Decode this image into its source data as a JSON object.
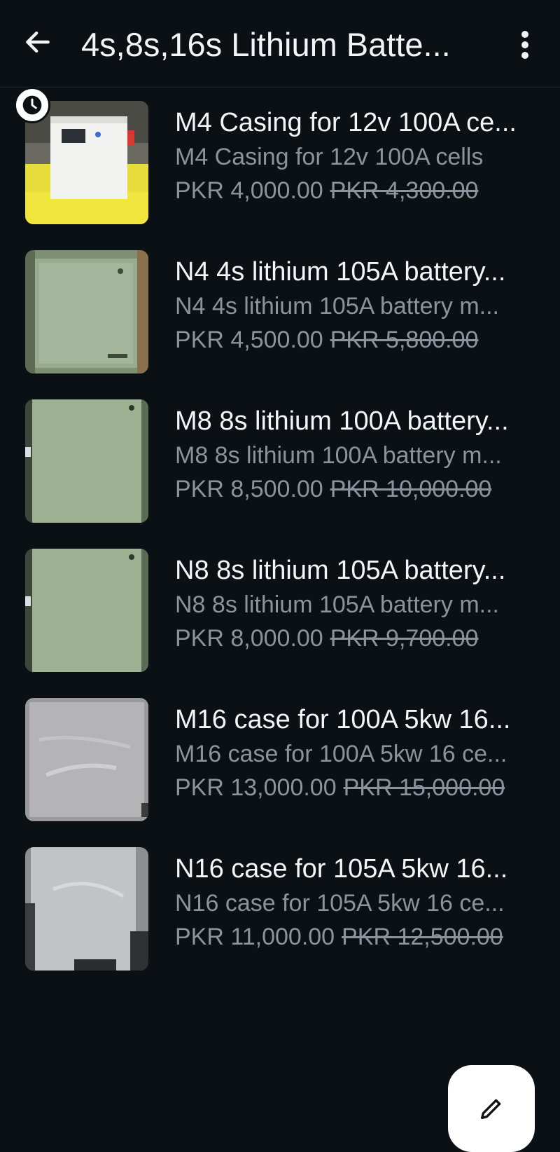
{
  "header": {
    "title": "4s,8s,16s Lithium Batte...",
    "back_icon": "arrow-left-icon",
    "menu_icon": "more-vert-icon"
  },
  "products": [
    {
      "name": "M4 Casing for 12v 100A ce...",
      "description": "M4 Casing for 12v 100A cells",
      "price": "PKR 4,000.00",
      "old_price": "PKR 4,300.00",
      "badge_icon": "clock-icon"
    },
    {
      "name": "N4 4s lithium 105A battery...",
      "description": "N4 4s lithium 105A battery m...",
      "price": "PKR 4,500.00",
      "old_price": "PKR 5,800.00"
    },
    {
      "name": "M8 8s lithium 100A battery...",
      "description": "M8 8s lithium 100A battery m...",
      "price": "PKR 8,500.00",
      "old_price": "PKR 10,000.00"
    },
    {
      "name": "N8 8s lithium 105A battery...",
      "description": "N8 8s lithium 105A battery m...",
      "price": "PKR 8,000.00",
      "old_price": "PKR 9,700.00"
    },
    {
      "name": "M16 case for 100A 5kw 16...",
      "description": "M16 case for 100A 5kw 16 ce...",
      "price": "PKR 13,000.00",
      "old_price": "PKR 15,000.00"
    },
    {
      "name": "N16 case for 105A 5kw 16...",
      "description": "N16 case for 105A 5kw 16 ce...",
      "price": "PKR 11,000.00",
      "old_price": "PKR 12,500.00"
    }
  ],
  "fab": {
    "icon": "edit-pencil-icon"
  },
  "colors": {
    "background": "#0b1015",
    "primary_text": "#f3f5f7",
    "secondary_text": "#8b949c",
    "fab": "#ffffff"
  }
}
